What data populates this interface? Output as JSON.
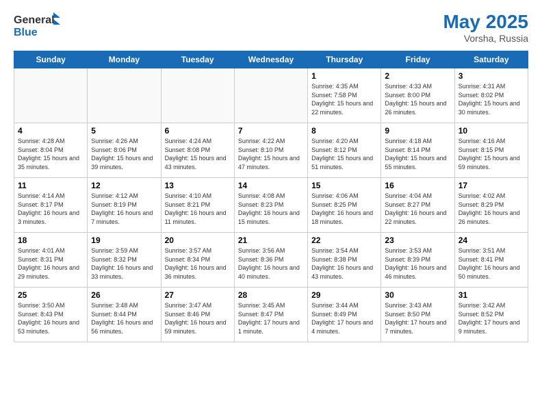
{
  "header": {
    "logo_general": "General",
    "logo_blue": "Blue",
    "title": "May 2025",
    "location": "Vorsha, Russia"
  },
  "weekdays": [
    "Sunday",
    "Monday",
    "Tuesday",
    "Wednesday",
    "Thursday",
    "Friday",
    "Saturday"
  ],
  "weeks": [
    [
      {
        "day": "",
        "info": ""
      },
      {
        "day": "",
        "info": ""
      },
      {
        "day": "",
        "info": ""
      },
      {
        "day": "",
        "info": ""
      },
      {
        "day": "1",
        "info": "Sunrise: 4:35 AM\nSunset: 7:58 PM\nDaylight: 15 hours\nand 22 minutes."
      },
      {
        "day": "2",
        "info": "Sunrise: 4:33 AM\nSunset: 8:00 PM\nDaylight: 15 hours\nand 26 minutes."
      },
      {
        "day": "3",
        "info": "Sunrise: 4:31 AM\nSunset: 8:02 PM\nDaylight: 15 hours\nand 30 minutes."
      }
    ],
    [
      {
        "day": "4",
        "info": "Sunrise: 4:28 AM\nSunset: 8:04 PM\nDaylight: 15 hours\nand 35 minutes."
      },
      {
        "day": "5",
        "info": "Sunrise: 4:26 AM\nSunset: 8:06 PM\nDaylight: 15 hours\nand 39 minutes."
      },
      {
        "day": "6",
        "info": "Sunrise: 4:24 AM\nSunset: 8:08 PM\nDaylight: 15 hours\nand 43 minutes."
      },
      {
        "day": "7",
        "info": "Sunrise: 4:22 AM\nSunset: 8:10 PM\nDaylight: 15 hours\nand 47 minutes."
      },
      {
        "day": "8",
        "info": "Sunrise: 4:20 AM\nSunset: 8:12 PM\nDaylight: 15 hours\nand 51 minutes."
      },
      {
        "day": "9",
        "info": "Sunrise: 4:18 AM\nSunset: 8:14 PM\nDaylight: 15 hours\nand 55 minutes."
      },
      {
        "day": "10",
        "info": "Sunrise: 4:16 AM\nSunset: 8:15 PM\nDaylight: 15 hours\nand 59 minutes."
      }
    ],
    [
      {
        "day": "11",
        "info": "Sunrise: 4:14 AM\nSunset: 8:17 PM\nDaylight: 16 hours\nand 3 minutes."
      },
      {
        "day": "12",
        "info": "Sunrise: 4:12 AM\nSunset: 8:19 PM\nDaylight: 16 hours\nand 7 minutes."
      },
      {
        "day": "13",
        "info": "Sunrise: 4:10 AM\nSunset: 8:21 PM\nDaylight: 16 hours\nand 11 minutes."
      },
      {
        "day": "14",
        "info": "Sunrise: 4:08 AM\nSunset: 8:23 PM\nDaylight: 16 hours\nand 15 minutes."
      },
      {
        "day": "15",
        "info": "Sunrise: 4:06 AM\nSunset: 8:25 PM\nDaylight: 16 hours\nand 18 minutes."
      },
      {
        "day": "16",
        "info": "Sunrise: 4:04 AM\nSunset: 8:27 PM\nDaylight: 16 hours\nand 22 minutes."
      },
      {
        "day": "17",
        "info": "Sunrise: 4:02 AM\nSunset: 8:29 PM\nDaylight: 16 hours\nand 26 minutes."
      }
    ],
    [
      {
        "day": "18",
        "info": "Sunrise: 4:01 AM\nSunset: 8:31 PM\nDaylight: 16 hours\nand 29 minutes."
      },
      {
        "day": "19",
        "info": "Sunrise: 3:59 AM\nSunset: 8:32 PM\nDaylight: 16 hours\nand 33 minutes."
      },
      {
        "day": "20",
        "info": "Sunrise: 3:57 AM\nSunset: 8:34 PM\nDaylight: 16 hours\nand 36 minutes."
      },
      {
        "day": "21",
        "info": "Sunrise: 3:56 AM\nSunset: 8:36 PM\nDaylight: 16 hours\nand 40 minutes."
      },
      {
        "day": "22",
        "info": "Sunrise: 3:54 AM\nSunset: 8:38 PM\nDaylight: 16 hours\nand 43 minutes."
      },
      {
        "day": "23",
        "info": "Sunrise: 3:53 AM\nSunset: 8:39 PM\nDaylight: 16 hours\nand 46 minutes."
      },
      {
        "day": "24",
        "info": "Sunrise: 3:51 AM\nSunset: 8:41 PM\nDaylight: 16 hours\nand 50 minutes."
      }
    ],
    [
      {
        "day": "25",
        "info": "Sunrise: 3:50 AM\nSunset: 8:43 PM\nDaylight: 16 hours\nand 53 minutes."
      },
      {
        "day": "26",
        "info": "Sunrise: 3:48 AM\nSunset: 8:44 PM\nDaylight: 16 hours\nand 56 minutes."
      },
      {
        "day": "27",
        "info": "Sunrise: 3:47 AM\nSunset: 8:46 PM\nDaylight: 16 hours\nand 59 minutes."
      },
      {
        "day": "28",
        "info": "Sunrise: 3:45 AM\nSunset: 8:47 PM\nDaylight: 17 hours\nand 1 minute."
      },
      {
        "day": "29",
        "info": "Sunrise: 3:44 AM\nSunset: 8:49 PM\nDaylight: 17 hours\nand 4 minutes."
      },
      {
        "day": "30",
        "info": "Sunrise: 3:43 AM\nSunset: 8:50 PM\nDaylight: 17 hours\nand 7 minutes."
      },
      {
        "day": "31",
        "info": "Sunrise: 3:42 AM\nSunset: 8:52 PM\nDaylight: 17 hours\nand 9 minutes."
      }
    ]
  ]
}
